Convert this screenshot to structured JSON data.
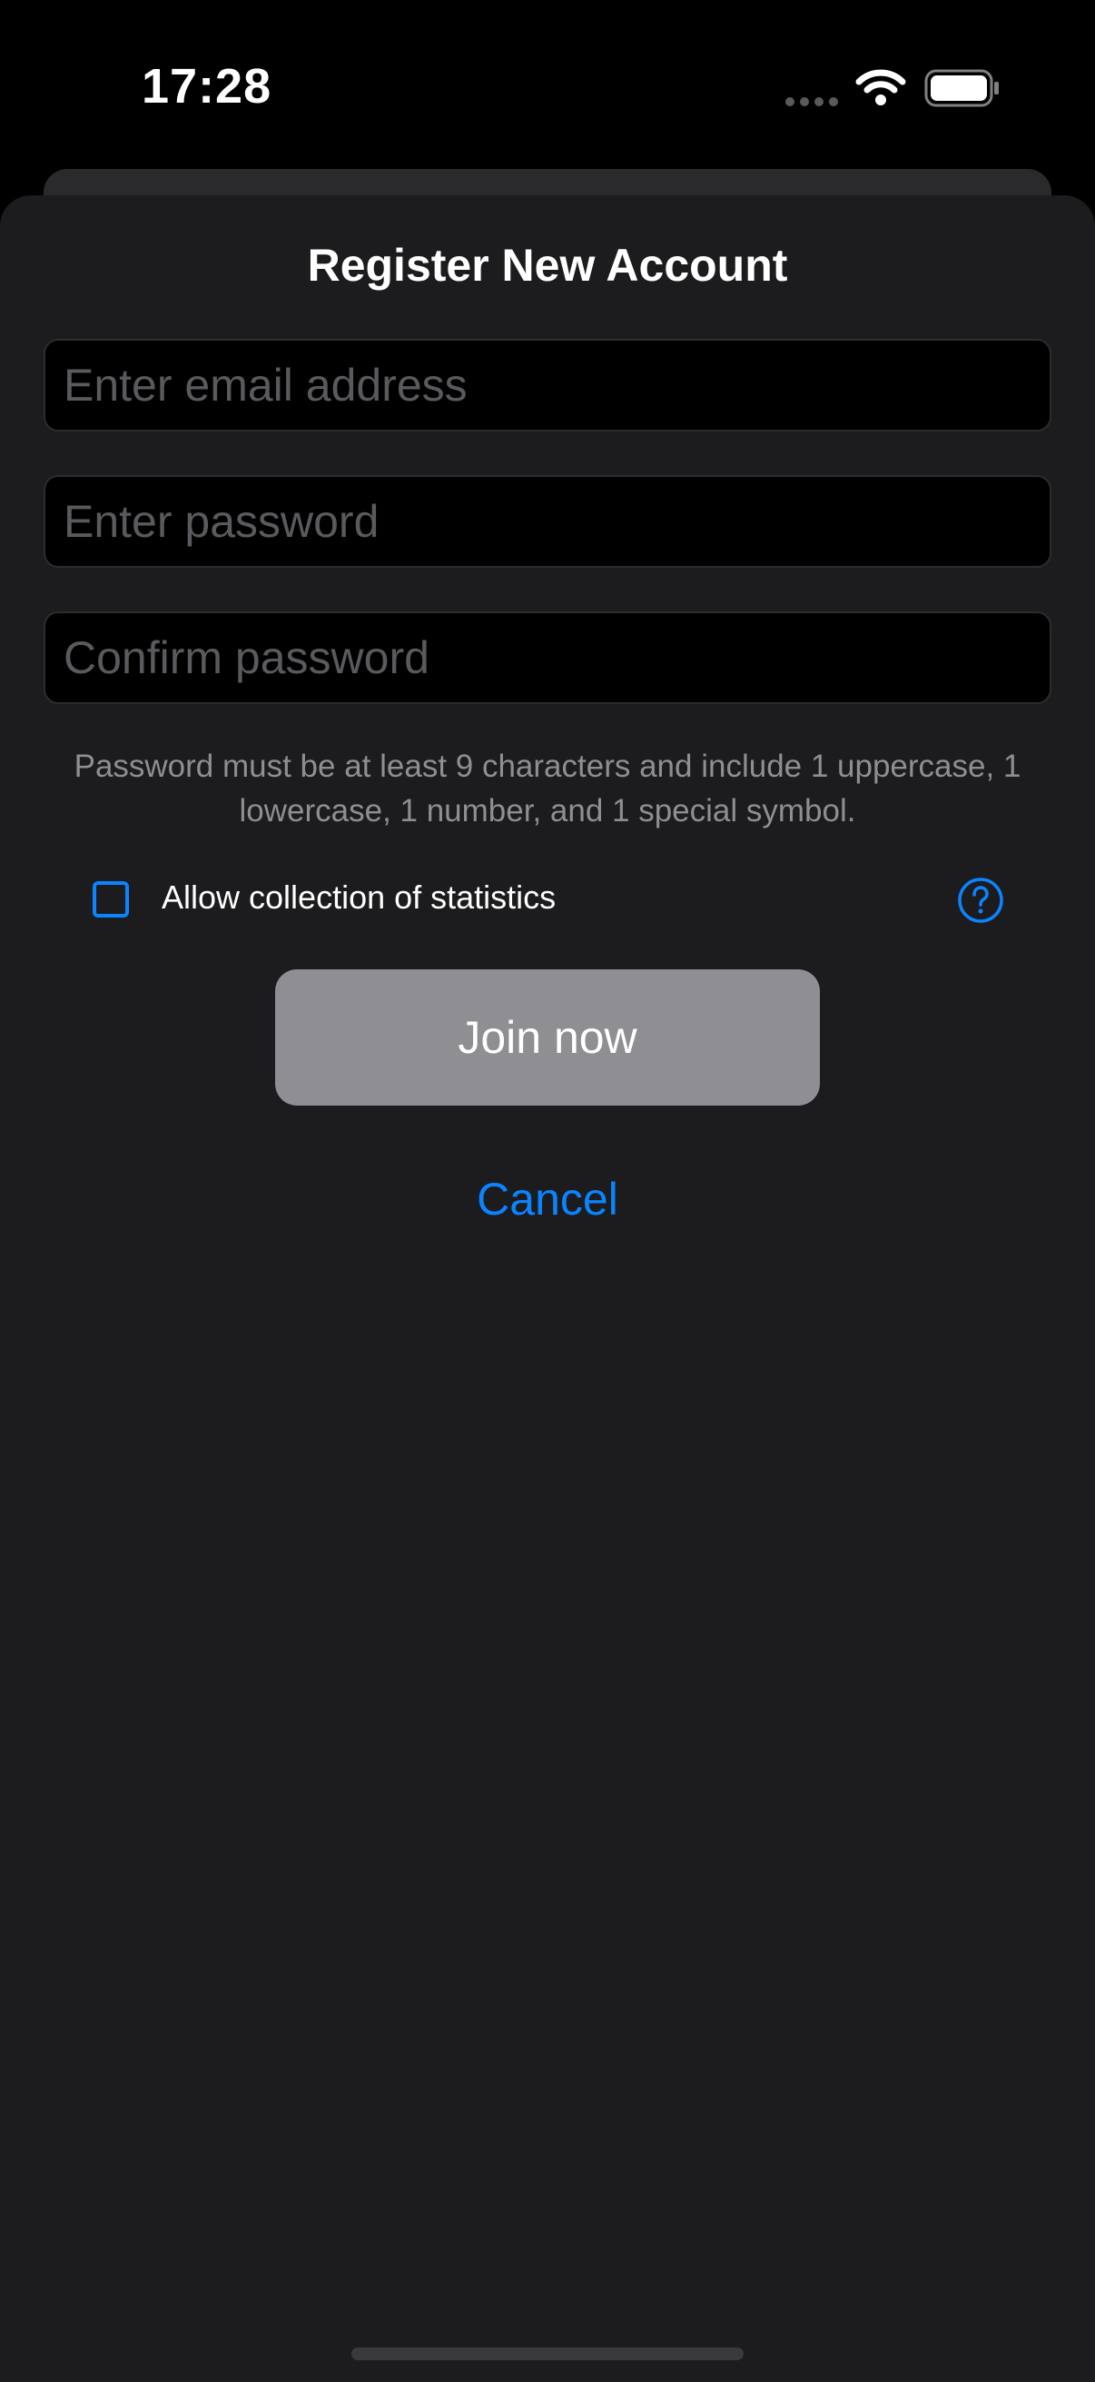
{
  "status_bar": {
    "time": "17:28",
    "icons": [
      "signal-dots-icon",
      "wifi-icon",
      "battery-icon"
    ]
  },
  "sheet": {
    "title": "Register New Account",
    "email_placeholder": "Enter email address",
    "email_value": "",
    "password_placeholder": "Enter password",
    "password_value": "",
    "confirm_placeholder": "Confirm password",
    "confirm_value": "",
    "hint": "Password must be at least 9 characters and include 1 uppercase, 1 lowercase, 1 number, and 1 special symbol.",
    "stats_label": "Allow collection of statistics",
    "stats_checked": false,
    "join_label": "Join now",
    "cancel_label": "Cancel"
  },
  "colors": {
    "accent": "#0a84ff",
    "sheet_background": "#1c1c1e",
    "field_background": "#000000",
    "button_disabled": "#8e8e93",
    "hint_text": "#8e8e93"
  }
}
